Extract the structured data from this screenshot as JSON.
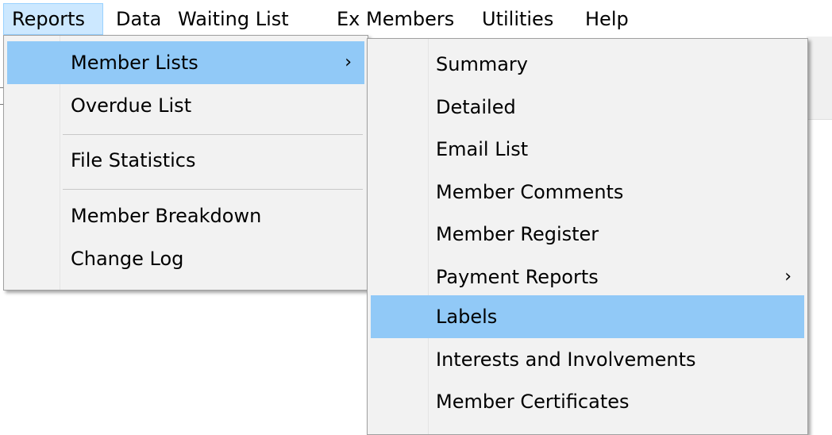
{
  "menubar": {
    "items": [
      "Reports",
      "Data",
      "Waiting List",
      "Ex Members",
      "Utilities",
      "Help"
    ]
  },
  "reports_menu": {
    "items": [
      {
        "label": "Member Lists",
        "arrow": "›"
      },
      {
        "label": "Overdue List"
      },
      {
        "label": "File Statistics"
      },
      {
        "label": "Member Breakdown"
      },
      {
        "label": "Change Log"
      }
    ]
  },
  "member_lists_menu": {
    "items": [
      {
        "label": "Summary"
      },
      {
        "label": "Detailed"
      },
      {
        "label": "Email List"
      },
      {
        "label": "Member Comments"
      },
      {
        "label": "Member Register"
      },
      {
        "label": "Payment Reports",
        "arrow": "›"
      },
      {
        "label": "Labels"
      },
      {
        "label": "Interests and Involvements"
      },
      {
        "label": "Member Certificates"
      }
    ]
  },
  "colors": {
    "menubar_active_bg": "#cce8ff",
    "menu_highlight_bg": "#91c9f7",
    "menu_bg": "#f2f2f2"
  }
}
